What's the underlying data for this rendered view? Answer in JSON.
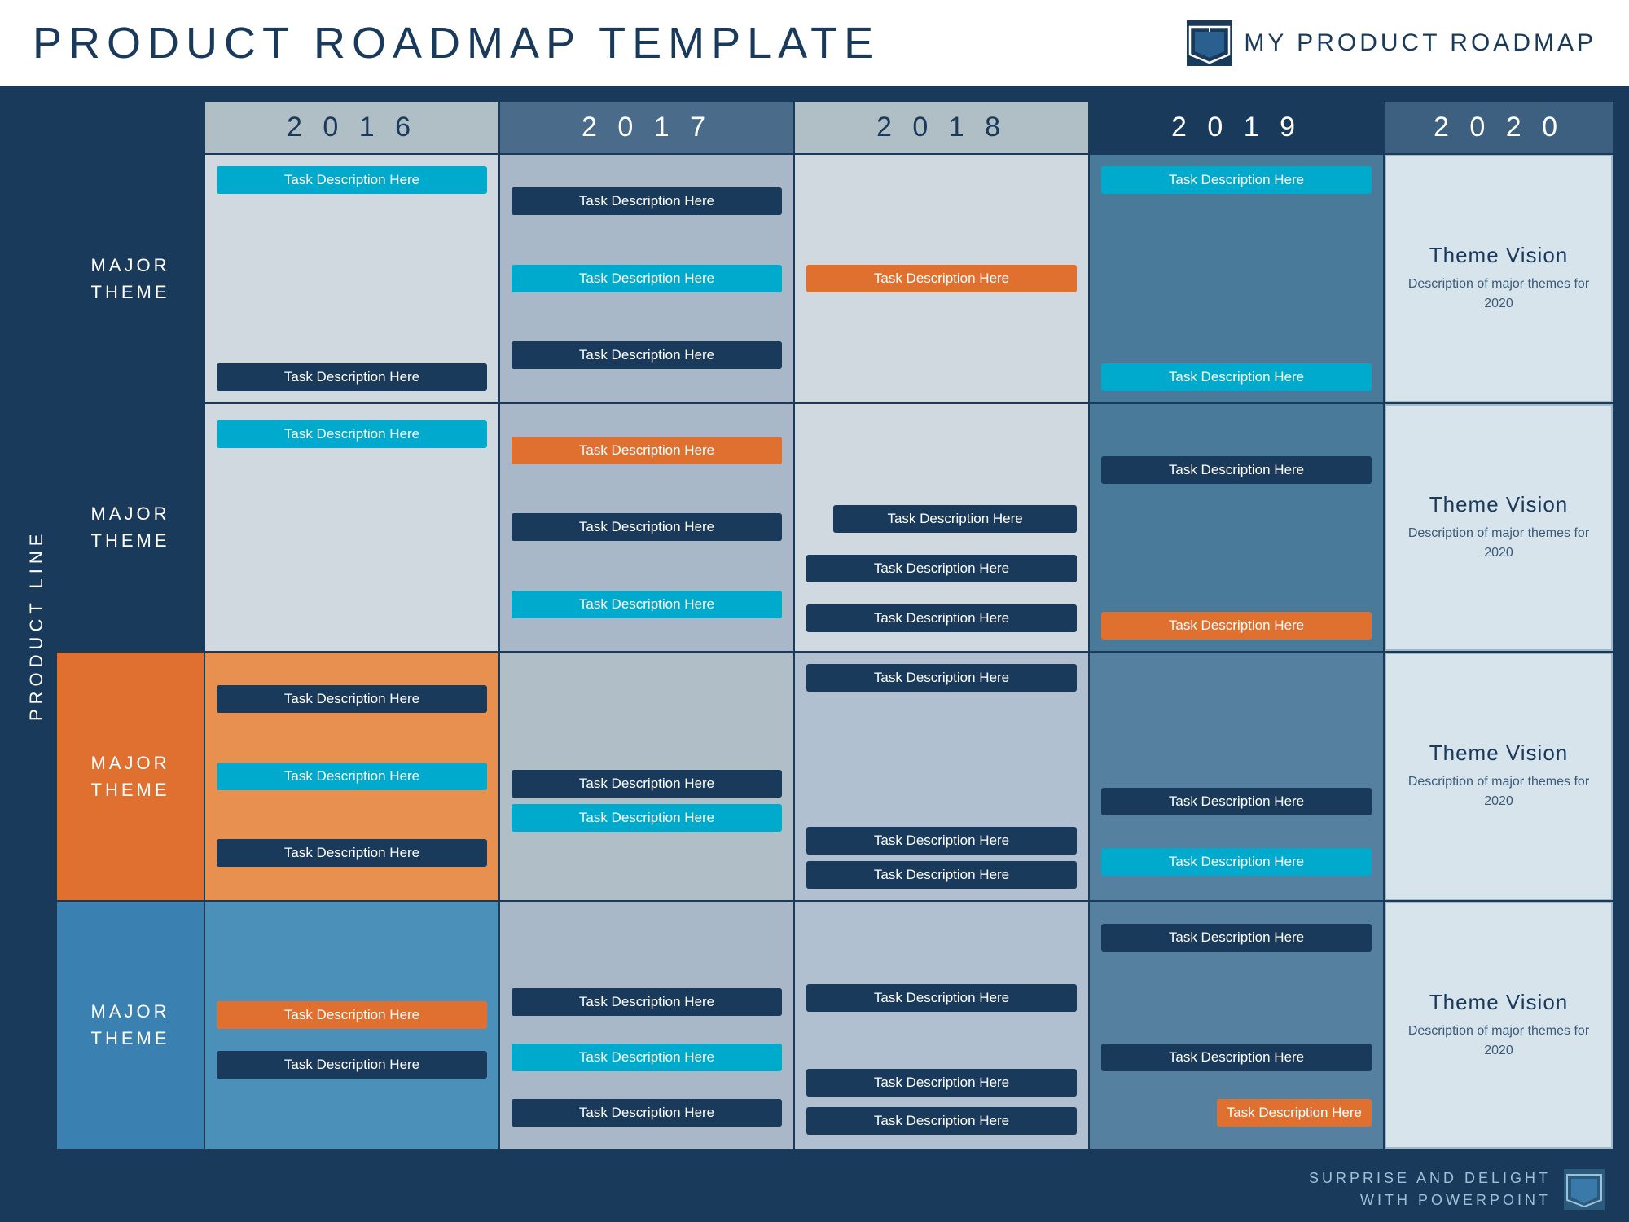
{
  "header": {
    "title": "PRODUCT  ROADMAP  TEMPLATE",
    "product_name": "MY  PRODUCT  ROADMAP"
  },
  "years": {
    "y2016": "2 0 1 6",
    "y2017": "2 0 1 7",
    "y2018": "2 0 1 8",
    "y2019": "2 0 1 9",
    "y2020": "2 0 2 0"
  },
  "product_line_label": "PRODUCT  LINE",
  "rows": [
    {
      "label_line1": "MAJOR",
      "label_line2": "THEME",
      "theme_vision_title": "Theme Vision",
      "theme_vision_desc": "Description of major themes for 2020"
    },
    {
      "label_line1": "MAJOR",
      "label_line2": "THEME",
      "theme_vision_title": "Theme Vision",
      "theme_vision_desc": "Description of major themes for 2020"
    },
    {
      "label_line1": "MAJOR",
      "label_line2": "THEME",
      "theme_vision_title": "Theme Vision",
      "theme_vision_desc": "Description of major themes for 2020"
    },
    {
      "label_line1": "MAJOR",
      "label_line2": "THEME",
      "theme_vision_title": "Theme Vision",
      "theme_vision_desc": "Description of major themes for 2020"
    }
  ],
  "tasks": {
    "r1_2016_t1": "Task Description Here",
    "r1_2016_t2": "Task Description Here",
    "r1_2017_t1": "Task Description Here",
    "r1_2017_t2": "Task Description Here",
    "r1_2017_t3": "Task Description Here",
    "r1_2018_t1": "Task Description Here",
    "r1_2019_t1": "Task Description Here",
    "r1_2019_t2": "Task Description Here",
    "r2_2016_t1": "Task Description Here",
    "r2_2017_t1": "Task Description Here",
    "r2_2017_t2": "Task Description Here",
    "r2_2017_t3": "Task Description Here",
    "r2_2018_t1": "Task Description Here",
    "r2_2018_t2": "Task Description Here",
    "r2_2018_t3": "Task Description Here",
    "r2_2019_t1": "Task Description Here",
    "r2_2019_t2": "Task Description Here",
    "r3_2016_t1": "Task Description Here",
    "r3_2016_t2": "Task Description Here",
    "r3_2016_t3": "Task Description Here",
    "r3_2017_t1": "Task Description Here",
    "r3_2017_t2": "Task Description Here",
    "r3_2018_t1": "Task Description Here",
    "r3_2018_t2": "Task Description Here",
    "r3_2018_t3": "Task Description Here",
    "r3_2019_t1": "Task Description Here",
    "r3_2019_t2": "Task Description Here",
    "r4_2016_t1": "Task Description Here",
    "r4_2016_t2": "Task Description Here",
    "r4_2017_t1": "Task Description Here",
    "r4_2017_t2": "Task Description Here",
    "r4_2017_t3": "Task Description Here",
    "r4_2018_t1": "Task Description Here",
    "r4_2018_t2": "Task Description Here",
    "r4_2018_t3": "Task Description Here",
    "r4_2019_t1": "Task Description Here",
    "r4_2019_t2": "Task Description Here"
  },
  "footer": {
    "line1": "SURPRISE AND DELIGHT",
    "line2": "WITH POWERPOINT"
  }
}
